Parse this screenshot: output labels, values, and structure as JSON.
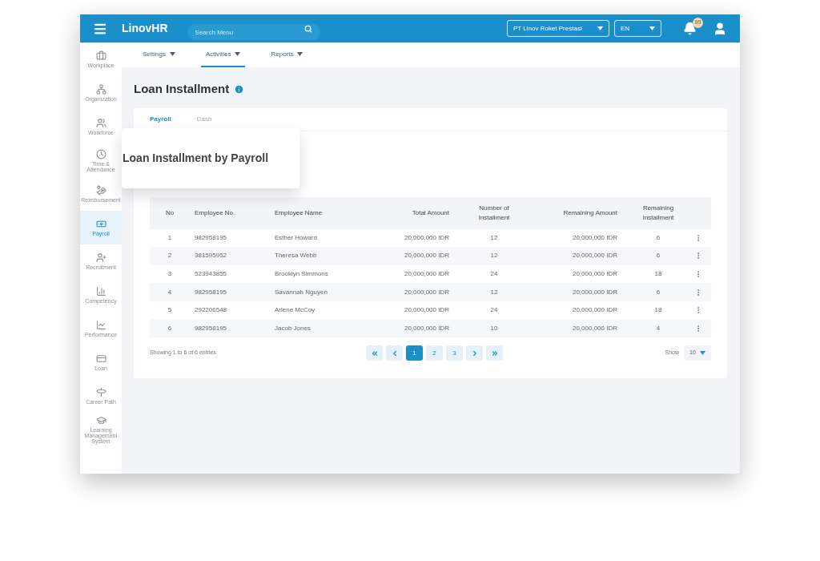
{
  "topbar": {
    "logo": "LinovHR",
    "search": {
      "placeholder": "Search Menu"
    },
    "company": "PT Linov Roket Prestasi",
    "language": "EN",
    "notifications": "99"
  },
  "subnav": [
    {
      "label": "Settings",
      "selected": false
    },
    {
      "label": "Activities",
      "selected": true
    },
    {
      "label": "Reports",
      "selected": false
    }
  ],
  "sidebar": [
    {
      "label": "Workplace",
      "selected": false
    },
    {
      "label": "Organization",
      "selected": false
    },
    {
      "label": "Workforce",
      "selected": false
    },
    {
      "label": "Time & Attendance",
      "selected": false
    },
    {
      "label": "Reimbursement",
      "selected": false
    },
    {
      "label": "Payroll",
      "selected": true
    },
    {
      "label": "Recruitment",
      "selected": false
    },
    {
      "label": "Competency",
      "selected": false
    },
    {
      "label": "Performance",
      "selected": false
    },
    {
      "label": "Loan",
      "selected": false
    },
    {
      "label": "Career Path",
      "selected": false
    },
    {
      "label": "Learning Management System",
      "selected": false
    }
  ],
  "page_title": "Loan Installment",
  "tabs": [
    {
      "label": "Payroll",
      "selected": true
    },
    {
      "label": "Cash",
      "selected": false
    }
  ],
  "card_title": "Loan Installment by Payroll",
  "table": {
    "columns": [
      "No",
      "Employee No.",
      "Employee Name",
      "Total Amount",
      "Number of Installment",
      "Remaining Amount",
      "Remaining Installment"
    ],
    "rows": [
      [
        "1",
        "982958195",
        "Esther Howard",
        "20,000,000 IDR",
        "12",
        "20,000,000 IDR",
        "6"
      ],
      [
        "2",
        "381595952",
        "Theresa Webb",
        "20,000,000 IDR",
        "12",
        "20,000,000 IDR",
        "6"
      ],
      [
        "3",
        "523943855",
        "Brooklyn Simmons",
        "20,000,000 IDR",
        "24",
        "20,000,000 IDR",
        "18"
      ],
      [
        "4",
        "982958195",
        "Savannah Nguyen",
        "20,000,000 IDR",
        "12",
        "20,000,000 IDR",
        "6"
      ],
      [
        "5",
        "292206548",
        "Arlene McCoy",
        "20,000,000 IDR",
        "24",
        "20,000,000 IDR",
        "18"
      ],
      [
        "6",
        "982958195",
        "Jacob Jones",
        "20,000,000 IDR",
        "10",
        "20,000,000 IDR",
        "4"
      ]
    ]
  },
  "footer": {
    "summary": "Showing 1 to 6 of 6 entries",
    "pages": [
      {
        "label": "1",
        "selected": true
      },
      {
        "label": "2",
        "selected": false
      },
      {
        "label": "3",
        "selected": false
      }
    ],
    "show_label": "Show",
    "page_size": "10"
  }
}
